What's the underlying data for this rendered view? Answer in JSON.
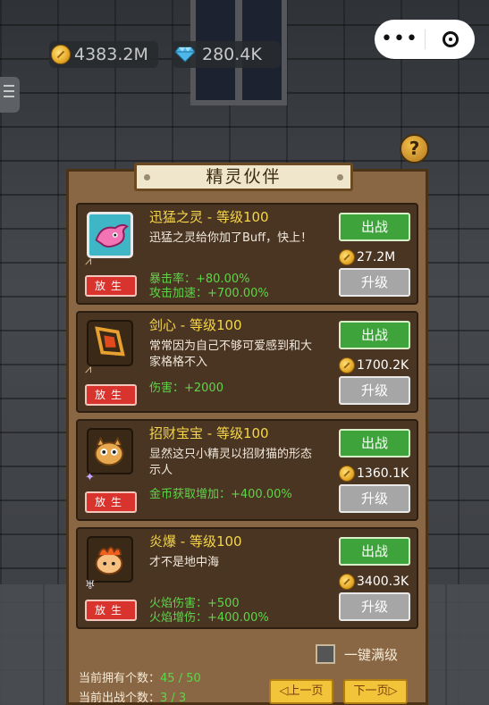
{
  "hud": {
    "gold": "4383.2M",
    "gems": "280.4K",
    "more_icon": "more-dots-icon",
    "close_icon": "target-circle-icon"
  },
  "panel": {
    "title": "精灵伙伴",
    "help_icon": "?"
  },
  "companions": [
    {
      "name": "迅猛之灵 - 等级100",
      "description": "迅猛之灵给你加了Buff，快上！",
      "stats": [
        "暴击率：+80.00%",
        "攻击加速：+700.00%"
      ],
      "release_label": "放生",
      "battle_label": "出战",
      "cost": "27.2M",
      "upgrade_label": "升级",
      "selected": true
    },
    {
      "name": "剑心 - 等级100",
      "description": "常常因为自己不够可爱感到和大家格格不入",
      "stats": [
        "伤害：+2000"
      ],
      "release_label": "放生",
      "battle_label": "出战",
      "cost": "1700.2K",
      "upgrade_label": "升级",
      "selected": false
    },
    {
      "name": "招财宝宝 - 等级100",
      "description": "显然这只小精灵以招财猫的形态示人",
      "stats": [
        "金币获取增加：+400.00%"
      ],
      "release_label": "放生",
      "battle_label": "出战",
      "cost": "1360.1K",
      "upgrade_label": "升级",
      "selected": false
    },
    {
      "name": "炎爆 - 等级100",
      "description": "才不是地中海",
      "stats": [
        "火焰伤害：+500",
        "火焰增伤：+400.00%"
      ],
      "release_label": "放生",
      "battle_label": "出战",
      "cost": "3400.3K",
      "upgrade_label": "升级",
      "selected": false
    }
  ],
  "footer": {
    "max_all_label": "一键满级",
    "owned_label": "当前拥有个数：",
    "owned_value": "45 / 50",
    "battling_label": "当前出战个数：",
    "battling_value": "3 / 3",
    "prev_label": "◁上一页",
    "next_label": "下一页▷"
  },
  "colors": {
    "panel": "#8a6744",
    "card": "#4a3522",
    "name": "#f5d64a",
    "stat": "#5fd34a",
    "battle_button": "#3fa33b",
    "upgrade_button": "#a6a6a6",
    "release_button": "#d8332c",
    "page_button": "#f2c43a"
  }
}
